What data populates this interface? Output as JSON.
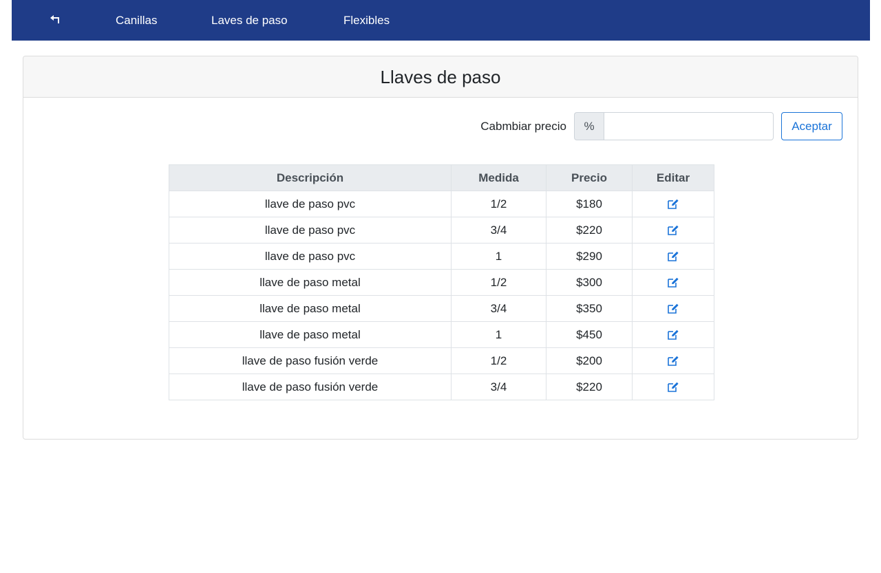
{
  "navbar": {
    "back_icon": "back-arrow-icon",
    "links": [
      "Canillas",
      "Laves de paso",
      "Flexibles"
    ]
  },
  "page": {
    "title": "Llaves de paso"
  },
  "price_change": {
    "label": "Cabmbiar precio",
    "addon": "%",
    "value": "",
    "accept_label": "Aceptar"
  },
  "table": {
    "headers": [
      "Descripción",
      "Medida",
      "Precio",
      "Editar"
    ],
    "rows": [
      {
        "descripcion": "llave de paso pvc",
        "medida": "1/2",
        "precio": "$180",
        "editar_icon": "edit-icon"
      },
      {
        "descripcion": "llave de paso pvc",
        "medida": "3/4",
        "precio": "$220",
        "editar_icon": "edit-icon"
      },
      {
        "descripcion": "llave de paso pvc",
        "medida": "1",
        "precio": "$290",
        "editar_icon": "edit-icon"
      },
      {
        "descripcion": "llave de paso metal",
        "medida": "1/2",
        "precio": "$300",
        "editar_icon": "edit-icon"
      },
      {
        "descripcion": "llave de paso metal",
        "medida": "3/4",
        "precio": "$350",
        "editar_icon": "edit-icon"
      },
      {
        "descripcion": "llave de paso metal",
        "medida": "1",
        "precio": "$450",
        "editar_icon": "edit-icon"
      },
      {
        "descripcion": "llave de paso fusión verde",
        "medida": "1/2",
        "precio": "$200",
        "editar_icon": "edit-icon"
      },
      {
        "descripcion": "llave de paso fusión verde",
        "medida": "3/4",
        "precio": "$220",
        "editar_icon": "edit-icon"
      }
    ]
  },
  "colors": {
    "navbar_bg": "#1f3c88",
    "accent": "#1a73d8",
    "header_bg": "#e9ecef"
  }
}
